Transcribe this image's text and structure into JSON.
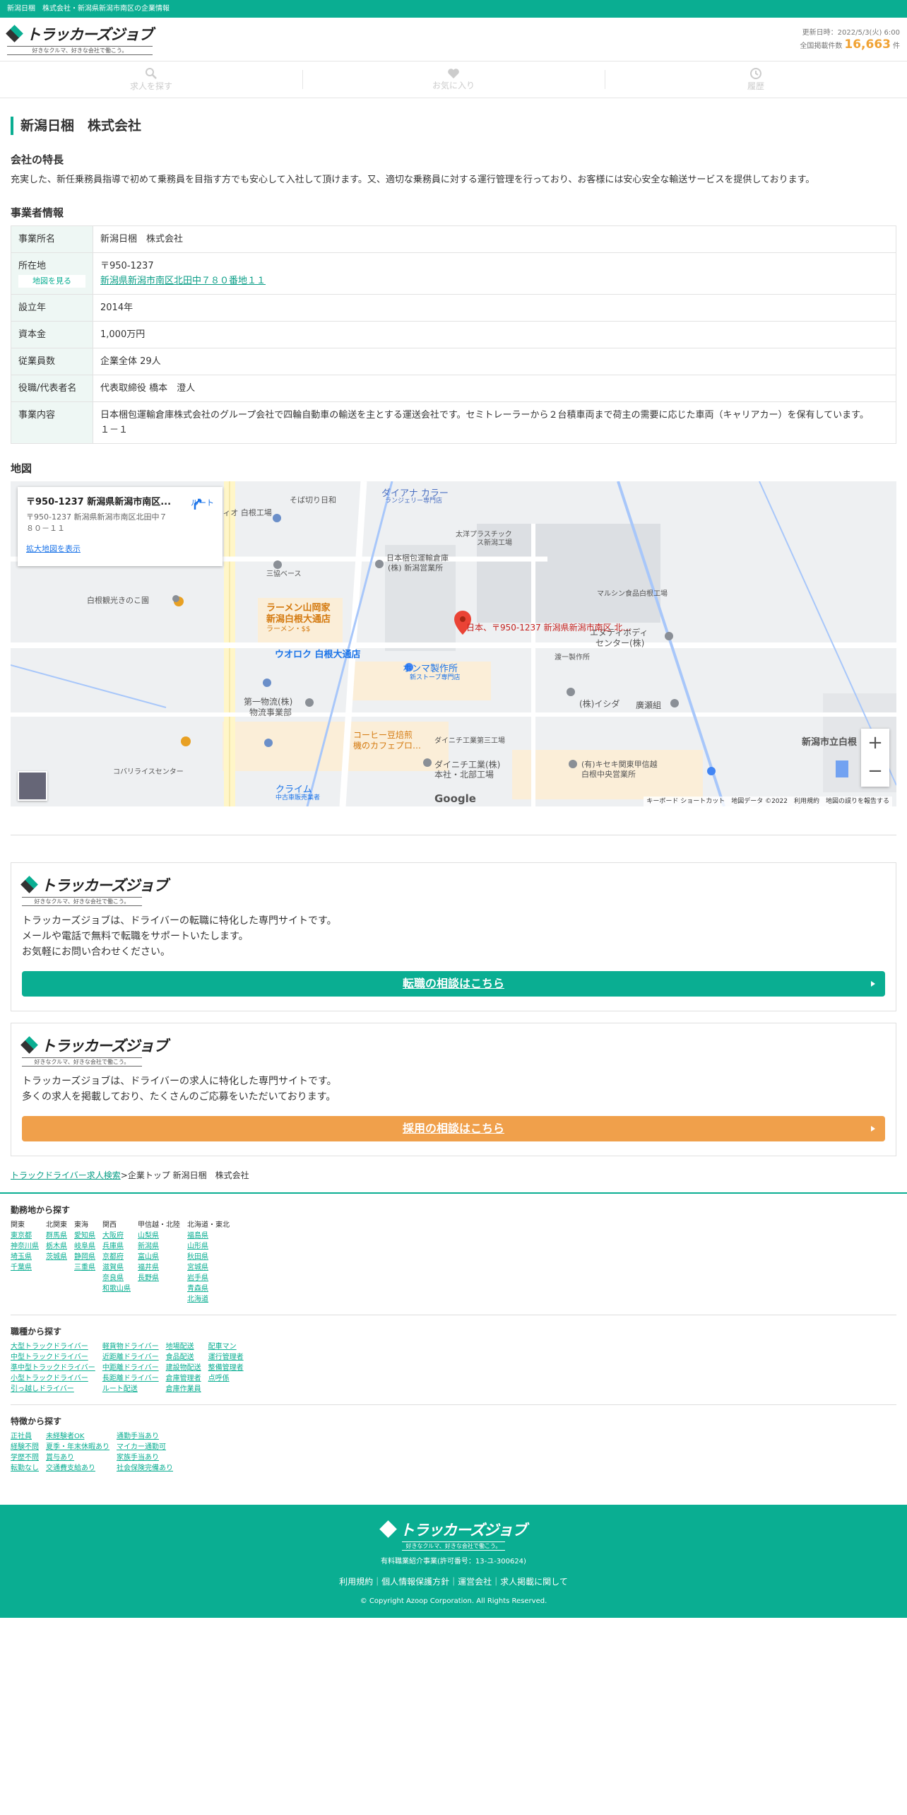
{
  "topbar": {
    "text": "新潟日梱　株式会社・新潟県新潟市南区の企業情報"
  },
  "header": {
    "logo_text": "トラッカーズジョブ",
    "logo_sub": "好きなクルマ、好きな会社で働こう。",
    "updated": "更新日時：2022/5/3(火) 6:00",
    "total_label": "全国掲載件数",
    "total_count": "16,663",
    "total_unit": "件"
  },
  "nav": {
    "search": "求人を探す",
    "favorite": "お気に入り",
    "history": "履歴"
  },
  "company": {
    "title": "新潟日梱　株式会社",
    "feature_heading": "会社の特長",
    "feature_text": "充実した、新任乗務員指導で初めて乗務員を目指す方でも安心して入社して頂けます。又、適切な乗務員に対する運行管理を行っており、お客様には安心安全な輸送サービスを提供しております。",
    "info_heading": "事業者情報",
    "rows": [
      {
        "label": "事業所名",
        "value": "新潟日梱　株式会社"
      },
      {
        "label": "設立年",
        "value": "2014年"
      },
      {
        "label": "資本金",
        "value": "1,000万円"
      },
      {
        "label": "従業員数",
        "value": "企業全体 29人"
      },
      {
        "label": "役職/代表者名",
        "value": "代表取締役 橋本　澄人"
      },
      {
        "label": "事業内容",
        "value": "日本梱包運輸倉庫株式会社のグループ会社で四輪自動車の輸送を主とする運送会社です。セミトレーラーから２台積車両まで荷主の需要に応じた車両（キャリアカー）を保有しています。　　　１－１"
      }
    ],
    "location_label": "所在地",
    "map_button": "地図を見る",
    "postal": "〒950-1237",
    "address_link": "新潟県新潟市南区北田中７８０番地１１"
  },
  "map": {
    "heading": "地図",
    "info_title": "〒950-1237 新潟県新潟市南区...",
    "info_addr": "〒950-1237 新潟県新潟市南区北田中７８０－１１",
    "info_large": "拡大地図を表示",
    "info_route": "ルート",
    "marker_label": "日本、〒950-1237 新潟県新潟市南区 北…",
    "google": "Google",
    "attribution": "キーボード ショートカット　地図データ ©2022　利用規約　地図の誤りを報告する",
    "zoom_in": "+",
    "zoom_out": "−",
    "places": [
      "ティオ 白根工場",
      "そば切り日和",
      "ダイアナ カラー",
      "ランジェリー専門店",
      "太洋プラスチック",
      "ス新潟工場",
      "三協ベース",
      "日本梱包運輸倉庫",
      "(株) 新潟営業所",
      "白根観光きのこ園",
      "ラーメン山岡家",
      "新潟白根大通店",
      "ラーメン・$$",
      "ウオロク 白根大通店",
      "ホンマ製作所",
      "新ストーブ専門店",
      "マルシン食品白根工場",
      "エヌティボディ",
      "センター(株)",
      "渡一製作所",
      "(株)イシダ",
      "廣瀬組",
      "第一物流(株)",
      "物流事業部",
      "ダイニチ工業第三工場",
      "コーヒー豆焙煎",
      "機のカフェプロ…",
      "ダイニチ工業(株)",
      "本社・北部工場",
      "(有)キセキ関東甲信越",
      "白根中央営業所",
      "新潟市立白根",
      "コバリライスセンター",
      "クライム",
      "中古車販売業者"
    ]
  },
  "cards": [
    {
      "text1": "トラッカーズジョブは、ドライバーの転職に特化した専門サイトです。",
      "text2": "メールや電話で無料で転職をサポートいたします。",
      "text3": "お気軽にお問い合わせください。",
      "button": "転職の相談はこちら"
    },
    {
      "text1": "トラッカーズジョブは、ドライバーの求人に特化した専門サイトです。",
      "text2": "多くの求人を掲載しており、たくさんのご応募をいただいております。",
      "button": "採用の相談はこちら"
    }
  ],
  "breadcrumb": {
    "link": "トラックドライバー求人検索",
    "sep": ">",
    "current": "企業トップ 新潟日梱　株式会社"
  },
  "footer_nav": {
    "area_heading": "勤務地から探す",
    "areas": [
      {
        "head": "関東",
        "items": [
          "東京都",
          "神奈川県",
          "埼玉県",
          "千葉県"
        ]
      },
      {
        "head": "北関東",
        "items": [
          "群馬県",
          "栃木県",
          "茨城県"
        ]
      },
      {
        "head": "東海",
        "items": [
          "愛知県",
          "岐阜県",
          "静岡県",
          "三重県"
        ]
      },
      {
        "head": "関西",
        "items": [
          "大阪府",
          "兵庫県",
          "京都府",
          "滋賀県",
          "奈良県",
          "和歌山県"
        ]
      },
      {
        "head": "甲信越・北陸",
        "items": [
          "山梨県",
          "新潟県",
          "富山県",
          "福井県",
          "長野県"
        ]
      },
      {
        "head": "北海道・東北",
        "items": [
          "福島県",
          "山形県",
          "秋田県",
          "宮城県",
          "岩手県",
          "青森県",
          "北海道"
        ]
      }
    ],
    "job_heading": "職種から探す",
    "jobs": [
      [
        "大型トラックドライバー",
        "中型トラックドライバー",
        "準中型トラックドライバー",
        "小型トラックドライバー",
        "引っ越しドライバー"
      ],
      [
        "軽貨物ドライバー",
        "近距離ドライバー",
        "中距離ドライバー",
        "長距離ドライバー",
        "ルート配送"
      ],
      [
        "地場配送",
        "食品配送",
        "建設物配送",
        "倉庫管理者",
        "倉庫作業員"
      ],
      [
        "配車マン",
        "運行管理者",
        "整備管理者",
        "点呼係"
      ]
    ],
    "feature_heading": "特徴から探す",
    "features": [
      [
        "正社員",
        "経験不問",
        "学歴不問",
        "転勤なし"
      ],
      [
        "未経験者OK",
        "夏季・年末休暇あり",
        "賞与あり",
        "交通費支給あり"
      ],
      [
        "通勤手当あり",
        "マイカー通勤可",
        "家族手当あり",
        "社会保険完備あり"
      ]
    ]
  },
  "footer": {
    "license": "有料職業紹介事業(許可番号：13-ユ-300624)",
    "links": "利用規約｜個人情報保護方針｜運営会社｜求人掲載に関して",
    "copyright": "© Copyright Azoop Corporation. All Rights Reserved."
  }
}
